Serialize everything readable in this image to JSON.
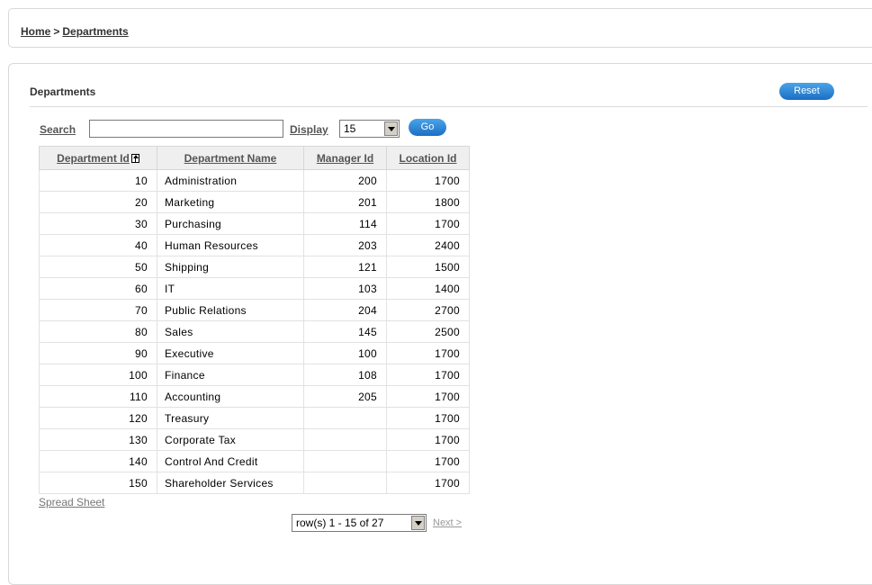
{
  "breadcrumb": {
    "home": "Home",
    "separator": ">",
    "current": "Departments"
  },
  "region": {
    "title": "Departments",
    "reset_label": "Reset"
  },
  "search": {
    "label": "Search",
    "value": "",
    "display_label": "Display",
    "display_value": "15",
    "go_label": "Go"
  },
  "table": {
    "columns": [
      "Department Id",
      "Department Name",
      "Manager Id",
      "Location Id"
    ],
    "sort_icon": "sort-ascending-icon",
    "rows": [
      [
        "10",
        "Administration",
        "200",
        "1700"
      ],
      [
        "20",
        "Marketing",
        "201",
        "1800"
      ],
      [
        "30",
        "Purchasing",
        "114",
        "1700"
      ],
      [
        "40",
        "Human Resources",
        "203",
        "2400"
      ],
      [
        "50",
        "Shipping",
        "121",
        "1500"
      ],
      [
        "60",
        "IT",
        "103",
        "1400"
      ],
      [
        "70",
        "Public Relations",
        "204",
        "2700"
      ],
      [
        "80",
        "Sales",
        "145",
        "2500"
      ],
      [
        "90",
        "Executive",
        "100",
        "1700"
      ],
      [
        "100",
        "Finance",
        "108",
        "1700"
      ],
      [
        "110",
        "Accounting",
        "205",
        "1700"
      ],
      [
        "120",
        "Treasury",
        "",
        "1700"
      ],
      [
        "130",
        "Corporate Tax",
        "",
        "1700"
      ],
      [
        "140",
        "Control And Credit",
        "",
        "1700"
      ],
      [
        "150",
        "Shareholder Services",
        "",
        "1700"
      ]
    ]
  },
  "footer": {
    "spreadsheet_label": "Spread Sheet",
    "pager_value": "row(s) 1 - 15 of 27",
    "next_label": "Next >"
  },
  "colors": {
    "button": "#1b6fc4",
    "header_bg": "#efefef",
    "border": "#d7d7d7"
  }
}
